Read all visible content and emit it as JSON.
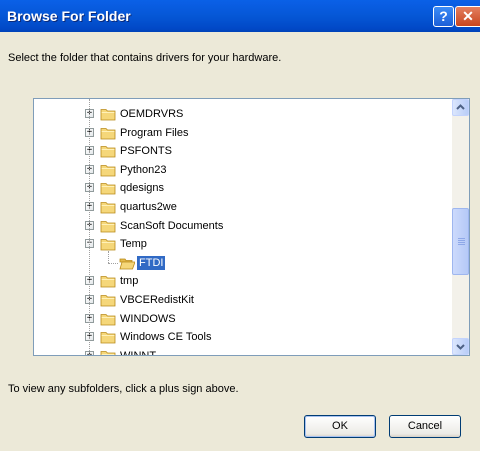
{
  "window": {
    "title": "Browse For Folder",
    "help_glyph": "?",
    "close_glyph": "✕"
  },
  "instruction": "Select the folder that contains drivers for your hardware.",
  "tree": {
    "items": [
      {
        "label": "OEMDRVRS",
        "expander": "+",
        "selected": false
      },
      {
        "label": "Program Files",
        "expander": "+",
        "selected": false
      },
      {
        "label": "PSFONTS",
        "expander": "+",
        "selected": false
      },
      {
        "label": "Python23",
        "expander": "+",
        "selected": false
      },
      {
        "label": "qdesigns",
        "expander": "+",
        "selected": false
      },
      {
        "label": "quartus2we",
        "expander": "+",
        "selected": false
      },
      {
        "label": "ScanSoft Documents",
        "expander": "+",
        "selected": false
      },
      {
        "label": "Temp",
        "expander": "−",
        "selected": false
      },
      {
        "label": "FTDI",
        "expander": "",
        "selected": true
      },
      {
        "label": "tmp",
        "expander": "+",
        "selected": false
      },
      {
        "label": "VBCERedistKit",
        "expander": "+",
        "selected": false
      },
      {
        "label": "WINDOWS",
        "expander": "+",
        "selected": false
      },
      {
        "label": "Windows CE Tools",
        "expander": "+",
        "selected": false
      },
      {
        "label": "WINNT",
        "expander": "+",
        "selected": false
      }
    ]
  },
  "hint": "To view any subfolders, click a plus sign above.",
  "buttons": {
    "ok": "OK",
    "cancel": "Cancel"
  },
  "colors": {
    "titlebar": "#0054e3",
    "selection": "#316ac5",
    "folder": "#f5d77a",
    "dialog_bg": "#ece9d8"
  }
}
